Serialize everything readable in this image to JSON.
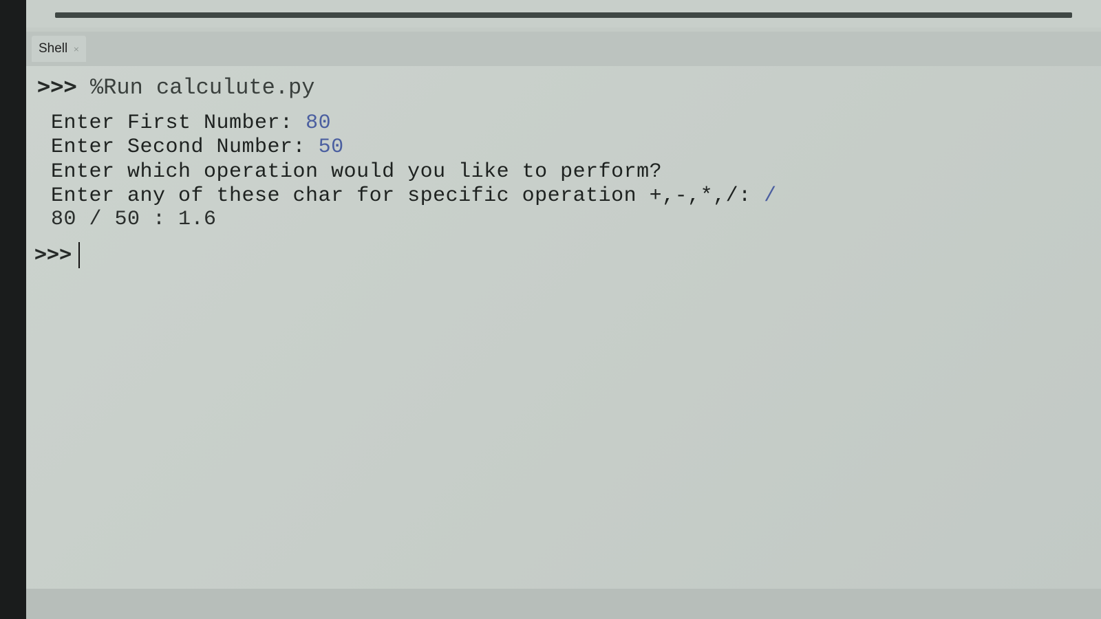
{
  "tabs": [
    {
      "label": "Shell",
      "close": "×"
    }
  ],
  "shell": {
    "command": {
      "prompt": ">>>",
      "text": "%Run calculute.py"
    },
    "output": [
      {
        "text": "Enter First Number: ",
        "input": "80"
      },
      {
        "text": "Enter Second Number: ",
        "input": "50"
      },
      {
        "text": "Enter which operation would you like to perform?",
        "input": ""
      },
      {
        "text": "Enter any of these char for specific operation +,-,*,/: ",
        "input": "/"
      },
      {
        "text": "80 / 50 : 1.6",
        "input": ""
      }
    ],
    "current_prompt": ">>>"
  },
  "colors": {
    "user_input": "#4b5fa0",
    "background": "#c9d0cb"
  }
}
